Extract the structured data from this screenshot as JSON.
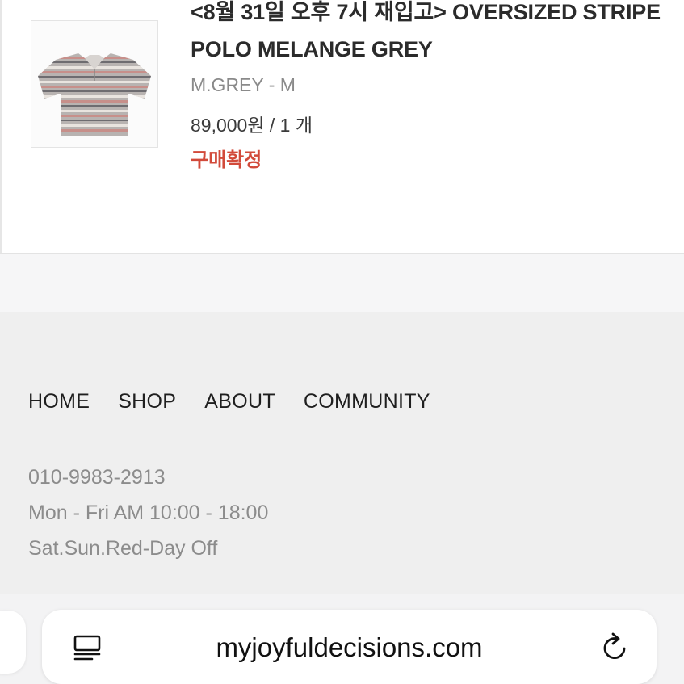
{
  "order": {
    "product_title": "<8월 31일 오후 7시 재입고> OVERSIZED STRIPE POLO MELANGE GREY",
    "option": "M.GREY - M",
    "price_qty": "89,000원 / 1 개",
    "status": "구매확정",
    "status_color": "#d24a3a",
    "thumbnail_icon": "striped-polo-shirt-image"
  },
  "footer": {
    "nav": [
      "HOME",
      "SHOP",
      "ABOUT",
      "COMMUNITY"
    ],
    "phone": "010-9983-2913",
    "hours_weekday": "Mon - Fri AM 10:00 - 18:00",
    "hours_weekend": "Sat.Sun.Red-Day Off"
  },
  "browser": {
    "url": "myjoyfuldecisions.com",
    "reader_icon": "reader-mode-icon",
    "reload_icon": "reload-icon"
  }
}
